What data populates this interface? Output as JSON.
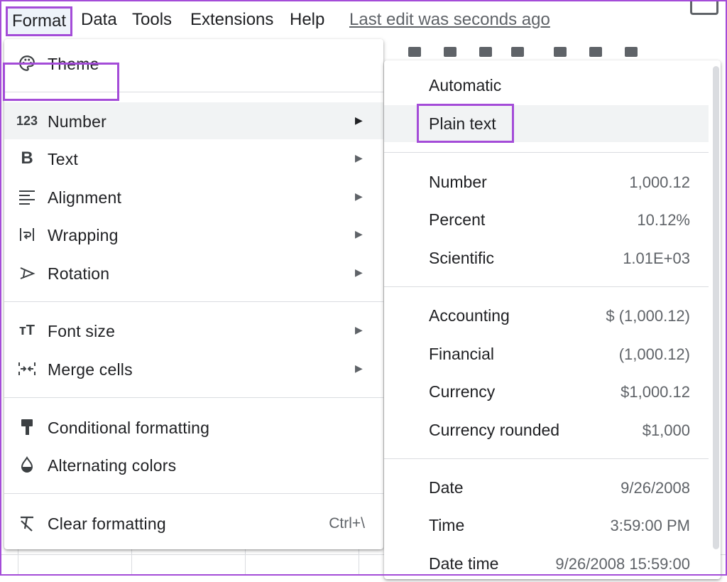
{
  "menubar": {
    "items": [
      "Format",
      "Data",
      "Tools",
      "Extensions",
      "Help"
    ],
    "last_edit": "Last edit was seconds ago"
  },
  "format_menu": {
    "items": [
      {
        "label": "Theme",
        "icon": "palette-icon"
      },
      {
        "label": "Number",
        "icon": "number-format-123-icon",
        "submenu": true
      },
      {
        "label": "Text",
        "icon": "bold-b-icon",
        "submenu": true
      },
      {
        "label": "Alignment",
        "icon": "align-left-icon",
        "submenu": true
      },
      {
        "label": "Wrapping",
        "icon": "text-wrap-icon",
        "submenu": true
      },
      {
        "label": "Rotation",
        "icon": "text-rotation-icon",
        "submenu": true
      },
      {
        "label": "Font size",
        "icon": "font-size-icon",
        "submenu": true
      },
      {
        "label": "Merge cells",
        "icon": "merge-cells-icon",
        "submenu": true
      },
      {
        "label": "Conditional formatting",
        "icon": "paint-roller-icon"
      },
      {
        "label": "Alternating colors",
        "icon": "fill-drop-icon"
      },
      {
        "label": "Clear formatting",
        "icon": "clear-format-icon",
        "shortcut": "Ctrl+\\"
      }
    ],
    "submenu_arrow": "▶"
  },
  "number_submenu": {
    "items": [
      {
        "label": "Automatic",
        "value": ""
      },
      {
        "label": "Plain text",
        "value": ""
      },
      {
        "label": "Number",
        "value": "1,000.12"
      },
      {
        "label": "Percent",
        "value": "10.12%"
      },
      {
        "label": "Scientific",
        "value": "1.01E+03"
      },
      {
        "label": "Accounting",
        "value": "$ (1,000.12)"
      },
      {
        "label": "Financial",
        "value": "(1,000.12)"
      },
      {
        "label": "Currency",
        "value": "$1,000.12"
      },
      {
        "label": "Currency rounded",
        "value": "$1,000"
      },
      {
        "label": "Date",
        "value": "9/26/2008"
      },
      {
        "label": "Time",
        "value": "3:59:00 PM"
      },
      {
        "label": "Date time",
        "value": "9/26/2008 15:59:00"
      }
    ]
  },
  "colors": {
    "highlight": "#a44cd8",
    "hover_bg": "#f1f3f4",
    "separator": "#dadce0"
  }
}
